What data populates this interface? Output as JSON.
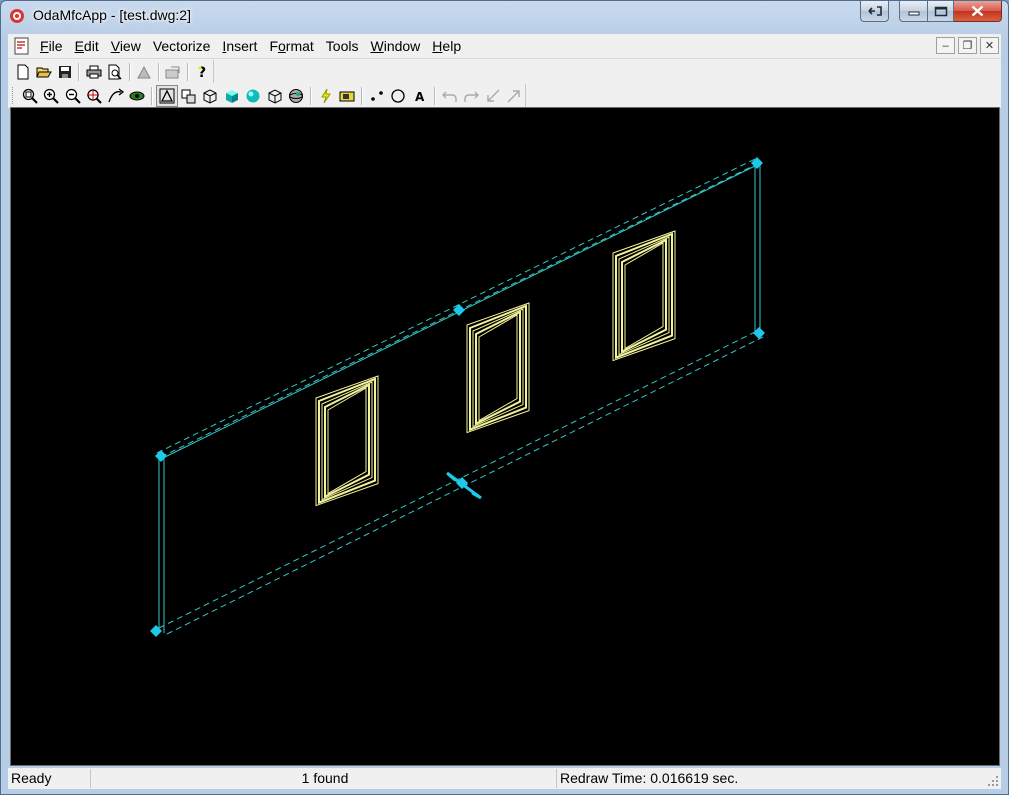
{
  "window": {
    "title": "OdaMfcApp - [test.dwg:2]",
    "icon": "oda-app-icon"
  },
  "caption_buttons": {
    "restore_app_icon": "restore-window-icon",
    "minimize_icon": "minimize-icon",
    "maximize_icon": "maximize-icon",
    "close_icon": "close-icon"
  },
  "menu": {
    "items": [
      {
        "label": "File",
        "accel": "F"
      },
      {
        "label": "Edit",
        "accel": "E"
      },
      {
        "label": "View",
        "accel": "V"
      },
      {
        "label": "Vectorize",
        "accel": "c"
      },
      {
        "label": "Insert",
        "accel": "I"
      },
      {
        "label": "Format",
        "accel": "o"
      },
      {
        "label": "Tools",
        "accel": ""
      },
      {
        "label": "Window",
        "accel": "W"
      },
      {
        "label": "Help",
        "accel": "H"
      }
    ],
    "mdi_buttons": [
      "mdi-minimize-icon",
      "mdi-restore-icon",
      "mdi-close-icon"
    ]
  },
  "toolbar_standard": [
    "new-file-icon",
    "open-folder-icon",
    "save-icon",
    "print-icon",
    "print-preview-icon",
    "pageset-icon",
    "export-icon",
    "help-icon"
  ],
  "toolbar_view": [
    "zoom-window-icon",
    "zoom-in-icon",
    "zoom-out-icon",
    "zoom-extents-icon",
    "pan-icon",
    "orbit-icon",
    "2d-wireframe-icon",
    "hidden-line-icon",
    "3d-wireframe-icon",
    "flat-shaded-icon",
    "gouraud-shaded-icon",
    "flat-edges-icon",
    "gouraud-edges-icon",
    "regen-icon",
    "render-icon",
    "point-icon",
    "circle-icon",
    "text-icon",
    "undo-icon",
    "redo-icon",
    "arrow-sw-icon",
    "arrow-ne-icon"
  ],
  "colors": {
    "viewport_bg": "#000000",
    "wall_lines": "#35c8c8",
    "window_frames": "#f3f39a",
    "grips": "#1ec8e8"
  },
  "status": {
    "ready": "Ready",
    "found": "1 found",
    "redraw": "Redraw Time: 0.016619 sec."
  }
}
